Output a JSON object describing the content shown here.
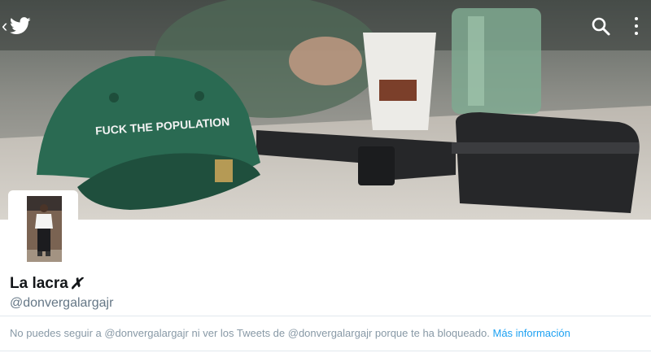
{
  "header": {
    "back_icon": "chevron-left-icon",
    "logo_icon": "twitter-bird-icon",
    "search_icon": "search-icon",
    "menu_icon": "vertical-ellipsis-icon"
  },
  "banner": {
    "cap_text": "FUCK THE POPULATION"
  },
  "profile": {
    "name": "La lacra",
    "name_suffix": "✗",
    "handle": "@donvergalargajr"
  },
  "notice": {
    "text": "No puedes seguir a @donvergalargajr ni ver los Tweets de @donvergalargajr porque te ha bloqueado.",
    "link": "Más información"
  },
  "colors": {
    "link": "#1da1f2",
    "muted": "#8899a6",
    "name": "#14171a",
    "handle": "#657786"
  }
}
